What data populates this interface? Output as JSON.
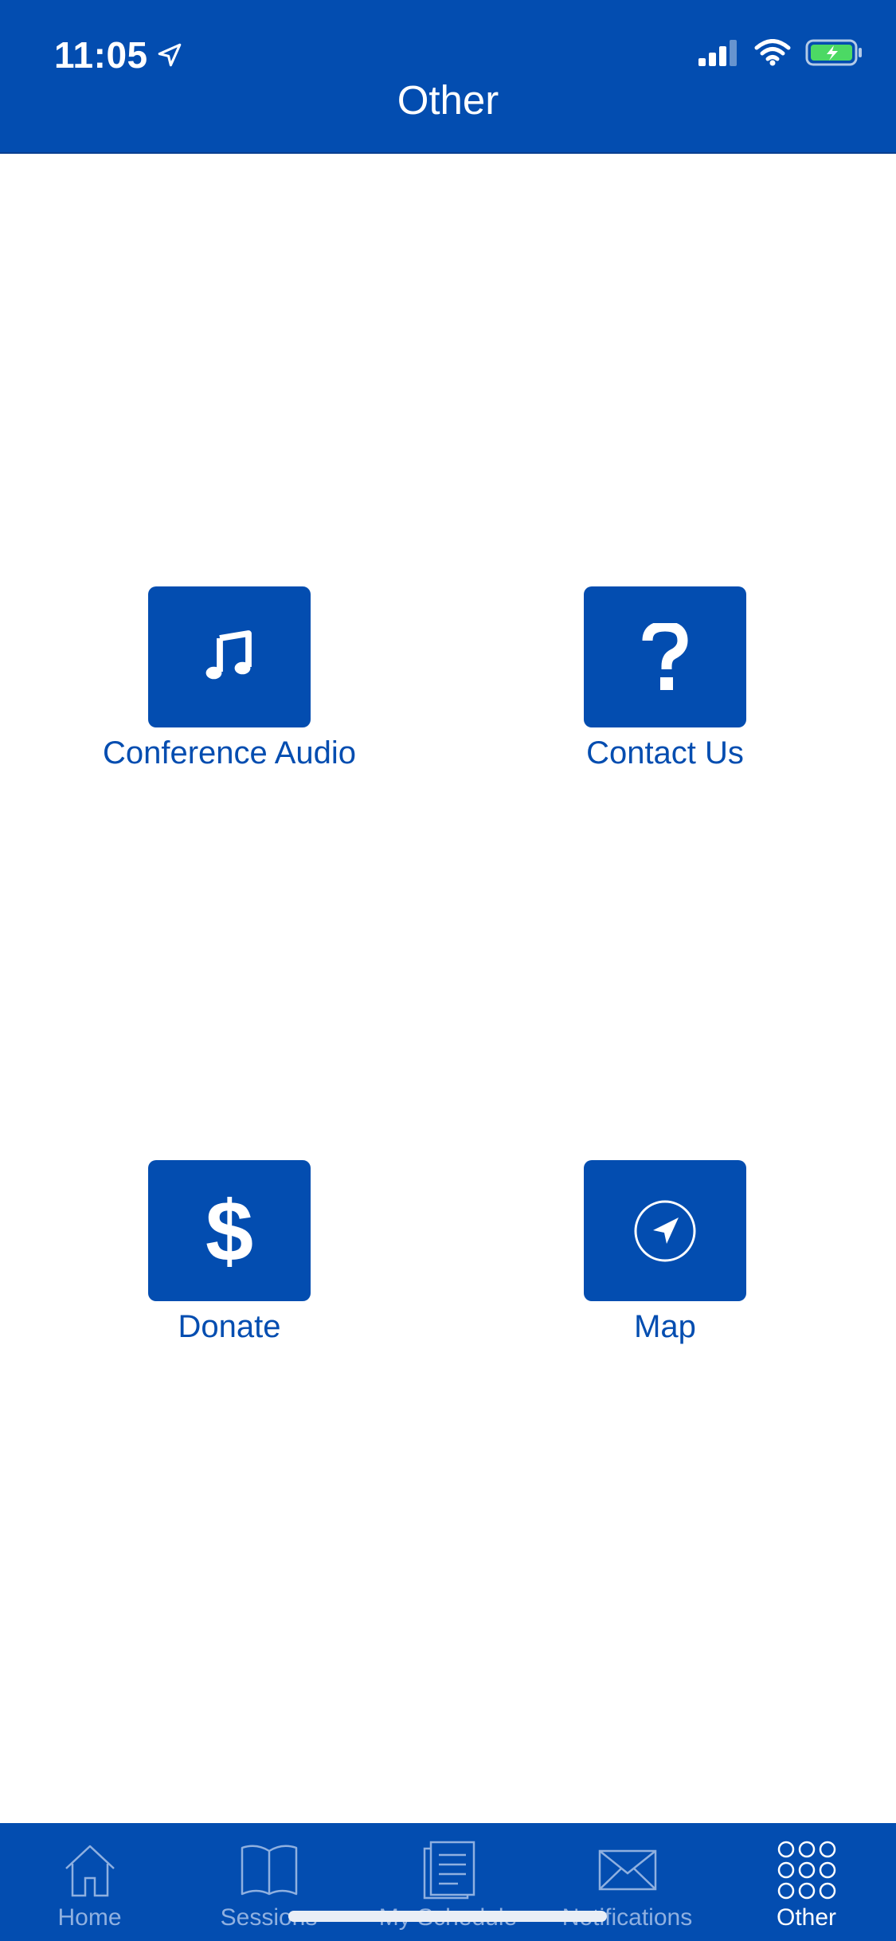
{
  "status_bar": {
    "time": "11:05"
  },
  "header": {
    "title": "Other"
  },
  "tiles": [
    {
      "label": "Conference Audio",
      "icon": "music-note-icon"
    },
    {
      "label": "Contact Us",
      "icon": "question-mark-icon"
    },
    {
      "label": "Donate",
      "icon": "dollar-sign-icon"
    },
    {
      "label": "Map",
      "icon": "compass-navigation-icon"
    }
  ],
  "tab_bar": {
    "items": [
      {
        "label": "Home",
        "icon": "home-icon"
      },
      {
        "label": "Sessions",
        "icon": "book-icon"
      },
      {
        "label": "My Schedule",
        "icon": "document-list-icon"
      },
      {
        "label": "Notifications",
        "icon": "envelope-icon"
      },
      {
        "label": "Other",
        "icon": "grid-dots-icon",
        "active": true
      }
    ]
  },
  "colors": {
    "brand_blue": "#034DB0",
    "inactive_tab_text": "#8fb0e0",
    "battery_green": "#4cd964"
  }
}
